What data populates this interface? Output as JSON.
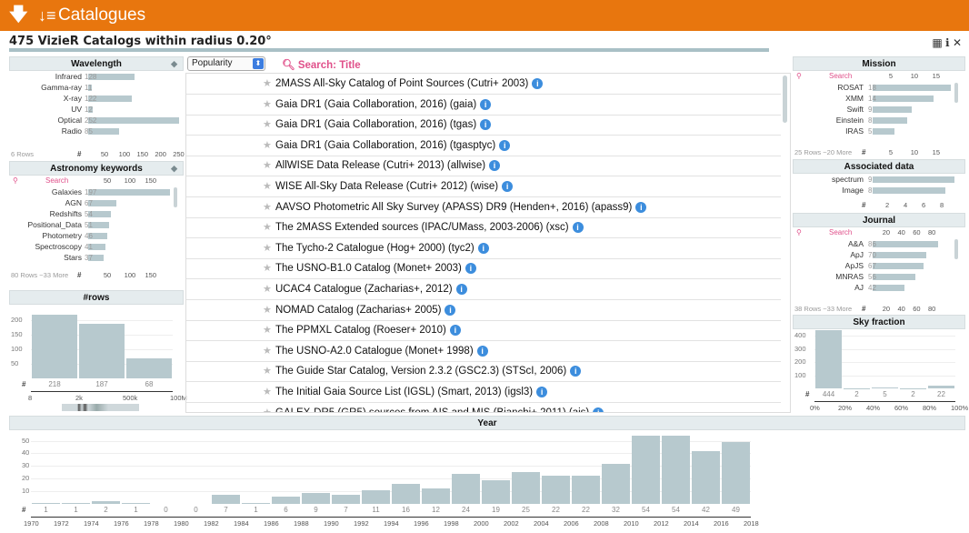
{
  "topbar": {
    "title": "Catalogues",
    "arrow": "🡇",
    "list_icon": "↓☰"
  },
  "header": {
    "title": "475 VizieR Catalogs within radius 0.20°",
    "icons": "▦ ℹ ✕"
  },
  "sort": {
    "selected": "Popularity",
    "search_placeholder": "Search: Title"
  },
  "wavelength": {
    "title": "Wavelength",
    "items": [
      {
        "label": "Infrared",
        "count": "128",
        "value": 128
      },
      {
        "label": "Gamma-ray",
        "count": "11",
        "value": 11
      },
      {
        "label": "X-ray",
        "count": "122",
        "value": 122
      },
      {
        "label": "UV",
        "count": "12",
        "value": 12
      },
      {
        "label": "Optical",
        "count": "252",
        "value": 252
      },
      {
        "label": "Radio",
        "count": "85",
        "value": 85
      }
    ],
    "footer_rows": "6 Rows",
    "axis_hash": "#",
    "axis_ticks": [
      "50",
      "100",
      "150",
      "200",
      "250"
    ]
  },
  "keywords": {
    "title": "Astronomy keywords",
    "search": "Search",
    "items": [
      {
        "label": "Galaxies",
        "count": "197",
        "value": 197
      },
      {
        "label": "AGN",
        "count": "67",
        "value": 67
      },
      {
        "label": "Redshifts",
        "count": "54",
        "value": 54
      },
      {
        "label": "Positional_Data",
        "count": "51",
        "value": 51
      },
      {
        "label": "Photometry",
        "count": "46",
        "value": 46
      },
      {
        "label": "Spectroscopy",
        "count": "41",
        "value": 41
      },
      {
        "label": "Stars",
        "count": "37",
        "value": 37
      }
    ],
    "top_ticks": [
      "50",
      "100",
      "150"
    ],
    "footer": "80 Rows ~33 More",
    "axis_hash": "#",
    "axis_ticks": [
      "50",
      "100",
      "150"
    ]
  },
  "rows_panel": {
    "title": "#rows",
    "y_ticks": [
      "200",
      "150",
      "100",
      "50"
    ],
    "bars": [
      {
        "count": "218",
        "value": 218
      },
      {
        "count": "187",
        "value": 187
      },
      {
        "count": "68",
        "value": 68
      }
    ],
    "hash": "#",
    "x_ticks": [
      "8",
      "2k",
      "500k",
      "100M"
    ]
  },
  "catalogs": [
    "2MASS All-Sky Catalog of Point Sources (Cutri+ 2003)",
    "Gaia DR1 (Gaia Collaboration, 2016) (gaia)",
    "Gaia DR1 (Gaia Collaboration, 2016) (tgas)",
    "Gaia DR1 (Gaia Collaboration, 2016) (tgasptyc)",
    "AllWISE Data Release (Cutri+ 2013) (allwise)",
    "WISE All-Sky Data Release (Cutri+ 2012) (wise)",
    "AAVSO Photometric All Sky Survey (APASS) DR9 (Henden+, 2016) (apass9)",
    "The 2MASS Extended sources (IPAC/UMass, 2003-2006) (xsc)",
    "The Tycho-2 Catalogue (Hog+ 2000) (tyc2)",
    "The USNO-B1.0 Catalog (Monet+ 2003)",
    "UCAC4 Catalogue (Zacharias+, 2012)",
    "NOMAD Catalog (Zacharias+ 2005)",
    "The PPMXL Catalog (Roeser+ 2010)",
    "The USNO-A2.0 Catalogue (Monet+ 1998)",
    "The Guide Star Catalog, Version 2.3.2 (GSC2.3) (STScI, 2006)",
    "The Initial Gaia Source List (IGSL) (Smart, 2013) (igsl3)",
    "GALEX-DR5 (GR5) sources from AIS and MIS (Bianchi+ 2011) (ais)"
  ],
  "mission": {
    "title": "Mission",
    "search": "Search",
    "top_ticks": [
      "5",
      "10",
      "15"
    ],
    "items": [
      {
        "label": "ROSAT",
        "count": "18",
        "value": 18
      },
      {
        "label": "XMM",
        "count": "14",
        "value": 14
      },
      {
        "label": "Swift",
        "count": "9",
        "value": 9
      },
      {
        "label": "Einstein",
        "count": "8",
        "value": 8
      },
      {
        "label": "IRAS",
        "count": "5",
        "value": 5
      }
    ],
    "footer": "25 Rows ~20 More",
    "axis_hash": "#",
    "axis_ticks": [
      "5",
      "10",
      "15"
    ]
  },
  "associated": {
    "title": "Associated data",
    "items": [
      {
        "label": "spectrum",
        "count": "9",
        "value": 9
      },
      {
        "label": "Image",
        "count": "8",
        "value": 8
      }
    ],
    "axis_hash": "#",
    "axis_ticks": [
      "2",
      "4",
      "6",
      "8"
    ]
  },
  "journal": {
    "title": "Journal",
    "search": "Search",
    "top_ticks": [
      "20",
      "40",
      "60",
      "80"
    ],
    "items": [
      {
        "label": "A&A",
        "count": "86",
        "value": 86
      },
      {
        "label": "ApJ",
        "count": "70",
        "value": 70
      },
      {
        "label": "ApJS",
        "count": "67",
        "value": 67
      },
      {
        "label": "MNRAS",
        "count": "56",
        "value": 56
      },
      {
        "label": "AJ",
        "count": "42",
        "value": 42
      }
    ],
    "footer": "38 Rows ~33 More",
    "axis_hash": "#",
    "axis_ticks": [
      "20",
      "40",
      "60",
      "80"
    ]
  },
  "sky": {
    "title": "Sky fraction",
    "y_ticks": [
      "400",
      "300",
      "200",
      "100"
    ],
    "bars": [
      {
        "count": "444",
        "value": 444
      },
      {
        "count": "2",
        "value": 2
      },
      {
        "count": "5",
        "value": 5
      },
      {
        "count": "2",
        "value": 2
      },
      {
        "count": "22",
        "value": 22
      }
    ],
    "hash": "#",
    "x_ticks": [
      "0%",
      "20%",
      "40%",
      "60%",
      "80%",
      "100%"
    ]
  },
  "year": {
    "title": "Year",
    "y_ticks": [
      "50",
      "40",
      "30",
      "20",
      "10"
    ],
    "hash": "#",
    "bars": [
      {
        "count": "1",
        "value": 1
      },
      {
        "count": "1",
        "value": 1
      },
      {
        "count": "2",
        "value": 2
      },
      {
        "count": "1",
        "value": 1
      },
      {
        "count": "0",
        "value": 0
      },
      {
        "count": "0",
        "value": 0
      },
      {
        "count": "7",
        "value": 7
      },
      {
        "count": "1",
        "value": 1
      },
      {
        "count": "6",
        "value": 6
      },
      {
        "count": "9",
        "value": 9
      },
      {
        "count": "7",
        "value": 7
      },
      {
        "count": "11",
        "value": 11
      },
      {
        "count": "16",
        "value": 16
      },
      {
        "count": "12",
        "value": 12
      },
      {
        "count": "24",
        "value": 24
      },
      {
        "count": "19",
        "value": 19
      },
      {
        "count": "25",
        "value": 25
      },
      {
        "count": "22",
        "value": 22
      },
      {
        "count": "22",
        "value": 22
      },
      {
        "count": "32",
        "value": 32
      },
      {
        "count": "54",
        "value": 54
      },
      {
        "count": "54",
        "value": 54
      },
      {
        "count": "42",
        "value": 42
      },
      {
        "count": "49",
        "value": 49
      }
    ],
    "x_ticks": [
      "1970",
      "1972",
      "1974",
      "1976",
      "1978",
      "1980",
      "1982",
      "1984",
      "1986",
      "1988",
      "1990",
      "1992",
      "1994",
      "1996",
      "1998",
      "2000",
      "2002",
      "2004",
      "2006",
      "2008",
      "2010",
      "2012",
      "2014",
      "2016",
      "2018"
    ]
  },
  "colors": {
    "accent": "#e8760e",
    "bar": "#b7c9ce",
    "search": "#e0508a",
    "info": "#3c8ddd"
  }
}
